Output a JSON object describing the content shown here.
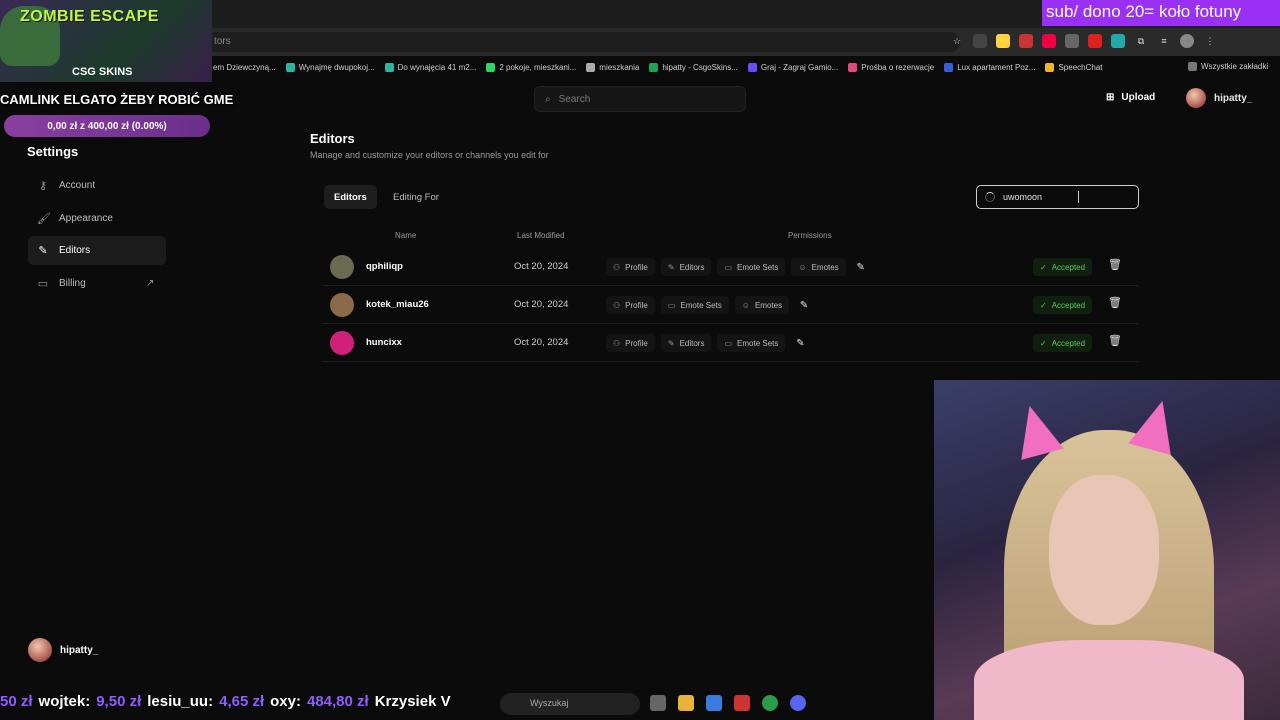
{
  "browser": {
    "url_fragment": "tors",
    "bookmarks": [
      {
        "label": "em Dziewczyną...",
        "color": "#888888"
      },
      {
        "label": "Wynajmę dwupokoj...",
        "color": "#2bb5a0"
      },
      {
        "label": "Do wynajęcia 41 m2...",
        "color": "#2bb5a0"
      },
      {
        "label": "2 pokoje, mieszkani...",
        "color": "#2bd56a"
      },
      {
        "label": "mieszkania",
        "color": "#aaaaaa"
      },
      {
        "label": "hipatty - CsgoSkins...",
        "color": "#1ea354"
      },
      {
        "label": "Graj - Zagraj Gamio...",
        "color": "#6b4cff"
      },
      {
        "label": "Prośba o rezerwacje",
        "color": "#e04a7a"
      },
      {
        "label": "Lux apartament Poz...",
        "color": "#3a5bd8"
      },
      {
        "label": "SpeechChat",
        "color": "#f0b429"
      }
    ],
    "all_bookmarks": "Wszystkie zakładki"
  },
  "overlay": {
    "game_title": "ZOMBIE ESCAPE",
    "sponsor": "CSG  SKINS",
    "banner": "CAMLINK ELGATO ŻEBY ROBIĆ GME",
    "progress_text": "0,00 zł z 400,00 zł (0.00%)",
    "progress_fraction": 0.0,
    "goal_text": "sub/ dono 20= koło fotuny",
    "ticker": [
      {
        "name": "wojtek:",
        "amount": "9,50 zł"
      },
      {
        "name": "lesiu_uu:",
        "amount": "4,65 zł"
      },
      {
        "name": "oxy:",
        "amount": "484,80 zł"
      },
      {
        "name": "Krzysiek V",
        "amount": ""
      }
    ],
    "ticker_prefix": "50 zł"
  },
  "taskbar": {
    "search_placeholder": "Wyszukaj"
  },
  "app": {
    "search_placeholder": "Search",
    "upload_label": "Upload",
    "username": "hipatty_",
    "sidebar": {
      "title": "Settings",
      "items": [
        {
          "label": "Account",
          "icon": "key-icon",
          "glyph": "⚷"
        },
        {
          "label": "Appearance",
          "icon": "palette-icon",
          "glyph": "🖌"
        },
        {
          "label": "Editors",
          "icon": "pencil-icon",
          "glyph": "✎"
        },
        {
          "label": "Billing",
          "icon": "card-icon",
          "glyph": "▭"
        }
      ]
    },
    "page": {
      "title": "Editors",
      "subtitle": "Manage and customize your editors or channels you edit for",
      "tabs": [
        "Editors",
        "Editing For"
      ],
      "search_value": "uwomoon",
      "columns": {
        "name": "Name",
        "modified": "Last Modified",
        "permissions": "Permissions"
      },
      "rows": [
        {
          "name": "qphiliqp",
          "date": "Oct 20, 2024",
          "avatar_color": "#6a6a52",
          "permissions": [
            "Profile",
            "Editors",
            "Emote Sets",
            "Emotes"
          ],
          "status": "Accepted"
        },
        {
          "name": "kotek_miau26",
          "date": "Oct 20, 2024",
          "avatar_color": "#8a6a4a",
          "permissions": [
            "Profile",
            "Emote Sets",
            "Emotes"
          ],
          "status": "Accepted"
        },
        {
          "name": "huncixx",
          "date": "Oct 20, 2024",
          "avatar_color": "#d0207a",
          "permissions": [
            "Profile",
            "Editors",
            "Emote Sets"
          ],
          "status": "Accepted"
        }
      ]
    }
  }
}
